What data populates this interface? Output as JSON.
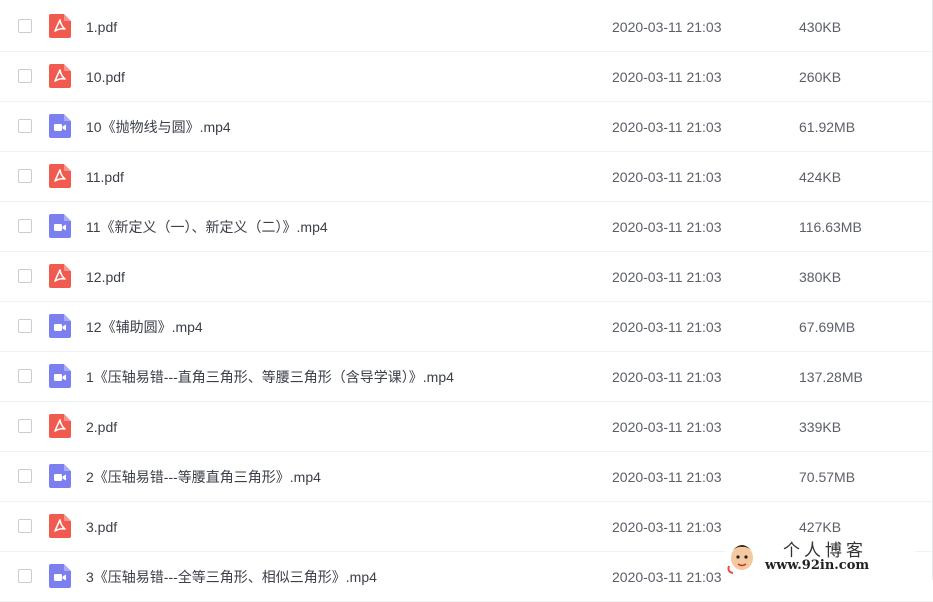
{
  "files": [
    {
      "name": "1.pdf",
      "date": "2020-03-11 21:03",
      "size": "430KB",
      "type": "pdf"
    },
    {
      "name": "10.pdf",
      "date": "2020-03-11 21:03",
      "size": "260KB",
      "type": "pdf"
    },
    {
      "name": "10《抛物线与圆》.mp4",
      "date": "2020-03-11 21:03",
      "size": "61.92MB",
      "type": "video"
    },
    {
      "name": "11.pdf",
      "date": "2020-03-11 21:03",
      "size": "424KB",
      "type": "pdf"
    },
    {
      "name": "11《新定义（一）、新定义（二）》.mp4",
      "date": "2020-03-11 21:03",
      "size": "116.63MB",
      "type": "video"
    },
    {
      "name": "12.pdf",
      "date": "2020-03-11 21:03",
      "size": "380KB",
      "type": "pdf"
    },
    {
      "name": "12《辅助圆》.mp4",
      "date": "2020-03-11 21:03",
      "size": "67.69MB",
      "type": "video"
    },
    {
      "name": "1《压轴易错---直角三角形、等腰三角形（含导学课）》.mp4",
      "date": "2020-03-11 21:03",
      "size": "137.28MB",
      "type": "video"
    },
    {
      "name": "2.pdf",
      "date": "2020-03-11 21:03",
      "size": "339KB",
      "type": "pdf"
    },
    {
      "name": "2《压轴易错---等腰直角三角形》.mp4",
      "date": "2020-03-11 21:03",
      "size": "70.57MB",
      "type": "video"
    },
    {
      "name": "3.pdf",
      "date": "2020-03-11 21:03",
      "size": "427KB",
      "type": "pdf"
    },
    {
      "name": "3《压轴易错---全等三角形、相似三角形》.mp4",
      "date": "2020-03-11 21:03",
      "size": "",
      "type": "video"
    }
  ],
  "icons": {
    "pdf": "pdf-file-icon",
    "video": "video-file-icon"
  },
  "colors": {
    "pdf": "#f05a4f",
    "video": "#7b7ff0"
  },
  "watermark": {
    "title": "个人博客",
    "url": "www.92in.com"
  }
}
